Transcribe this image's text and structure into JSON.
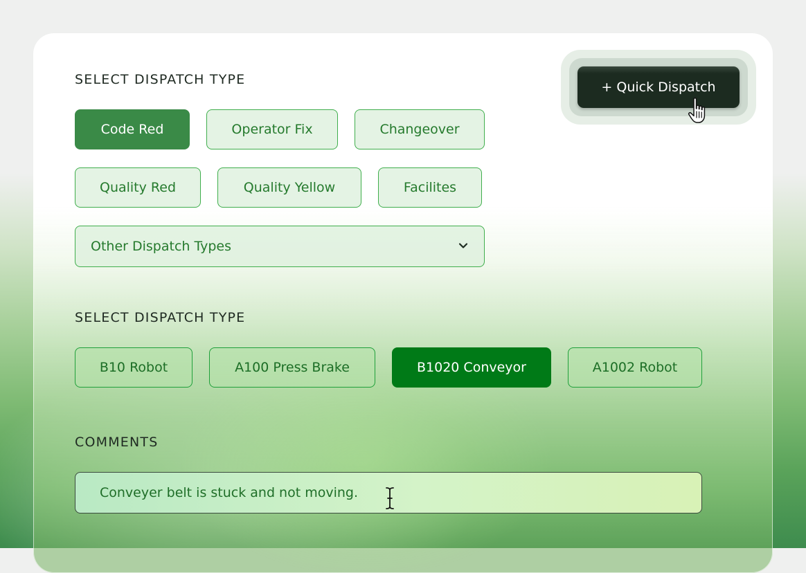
{
  "dispatch_type": {
    "label": "SELECT DISPATCH TYPE",
    "options": [
      "Code Red",
      "Operator Fix",
      "Changeover",
      "Quality Red",
      "Quality Yellow",
      "Facilites"
    ],
    "selected": "Code Red",
    "other_select": "Other Dispatch Types"
  },
  "machine": {
    "label": "SELECT DISPATCH TYPE",
    "options": [
      "B10 Robot",
      "A100 Press Brake",
      "B1020 Conveyor",
      "A1002 Robot"
    ],
    "selected": "B1020 Conveyor"
  },
  "comments": {
    "label": "COMMENTS",
    "value": "Conveyer belt is stuck and not moving."
  },
  "quick_dispatch": {
    "label": "+ Quick Dispatch"
  },
  "icons": {
    "select_chevron": "chevron-down-icon",
    "hand_cursor": "hand-pointer-cursor",
    "text_cursor": "ibeam-cursor"
  },
  "colors": {
    "primary_dark": "#3a8a47",
    "primary_bright": "#007a17",
    "chip_text": "#257a2d",
    "chip_border": "#3fae4c",
    "quick_dispatch_bg": "#1c2b20"
  }
}
